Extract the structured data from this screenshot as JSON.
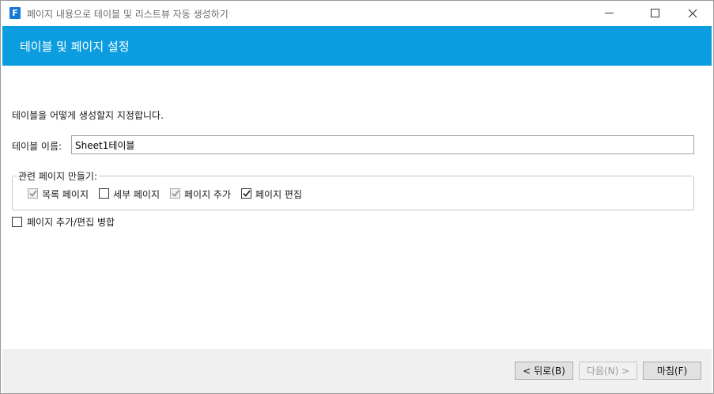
{
  "window": {
    "title": "페이지 내용으로 테이블 및 리스트뷰 자동 생성하기",
    "app_icon_letter": "F"
  },
  "header": {
    "title": "테이블 및 페이지 설정"
  },
  "body": {
    "instruction": "테이블을 어떻게 생성할지 지정합니다.",
    "table_name_label": "테이블 이름:",
    "table_name_value": "Sheet1테이블",
    "group_label": "관련 페이지 만들기:",
    "checkboxes": [
      {
        "label": "목록 페이지",
        "checked": true,
        "enabled": false
      },
      {
        "label": "세부 페이지",
        "checked": false,
        "enabled": true
      },
      {
        "label": "페이지 추가",
        "checked": true,
        "enabled": false
      },
      {
        "label": "페이지 편집",
        "checked": true,
        "enabled": true
      }
    ],
    "merge": {
      "label": "페이지 추가/편집 병합",
      "checked": false
    }
  },
  "footer": {
    "back_label": "< 뒤로(B)",
    "next_label": "다음(N) >",
    "finish_label": "마침(F)"
  },
  "colors": {
    "header_bg": "#0b9de0",
    "footer_bg": "#f0f0f0"
  }
}
